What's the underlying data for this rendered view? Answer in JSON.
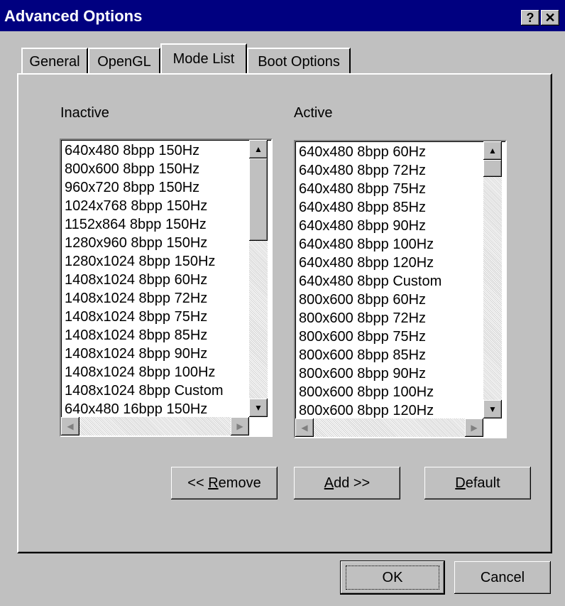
{
  "window": {
    "title": "Advanced Options",
    "help_label": "?",
    "close_label": "✕"
  },
  "tabs": [
    {
      "label": "General"
    },
    {
      "label": "OpenGL"
    },
    {
      "label": "Mode List"
    },
    {
      "label": "Boot Options"
    }
  ],
  "active_tab": "Mode List",
  "inactive": {
    "label": "Inactive",
    "items": [
      "640x480 8bpp 150Hz",
      "800x600 8bpp 150Hz",
      "960x720 8bpp 150Hz",
      "1024x768 8bpp 150Hz",
      "1152x864 8bpp 150Hz",
      "1280x960 8bpp 150Hz",
      "1280x1024 8bpp 150Hz",
      "1408x1024 8bpp 60Hz",
      "1408x1024 8bpp 72Hz",
      "1408x1024 8bpp 75Hz",
      "1408x1024 8bpp 85Hz",
      "1408x1024 8bpp 90Hz",
      "1408x1024 8bpp 100Hz",
      "1408x1024 8bpp Custom",
      "640x480 16bpp 150Hz"
    ]
  },
  "active": {
    "label": "Active",
    "items": [
      "640x480 8bpp 60Hz",
      "640x480 8bpp 72Hz",
      "640x480 8bpp 75Hz",
      "640x480 8bpp 85Hz",
      "640x480 8bpp 90Hz",
      "640x480 8bpp 100Hz",
      "640x480 8bpp 120Hz",
      "640x480 8bpp Custom",
      "800x600 8bpp 60Hz",
      "800x600 8bpp 72Hz",
      "800x600 8bpp 75Hz",
      "800x600 8bpp 85Hz",
      "800x600 8bpp 90Hz",
      "800x600 8bpp 100Hz",
      "800x600 8bpp 120Hz"
    ]
  },
  "buttons": {
    "remove_prefix": "<< ",
    "remove_mnemonic": "R",
    "remove_rest": "emove",
    "add_mnemonic": "A",
    "add_rest": "dd >>",
    "default_mnemonic": "D",
    "default_rest": "efault",
    "ok": "OK",
    "cancel": "Cancel"
  },
  "scroll_icons": {
    "up": "▲",
    "down": "▼",
    "left": "◀",
    "right": "▶"
  },
  "colors": {
    "titlebar": "#000080",
    "face": "#c0c0c0"
  }
}
